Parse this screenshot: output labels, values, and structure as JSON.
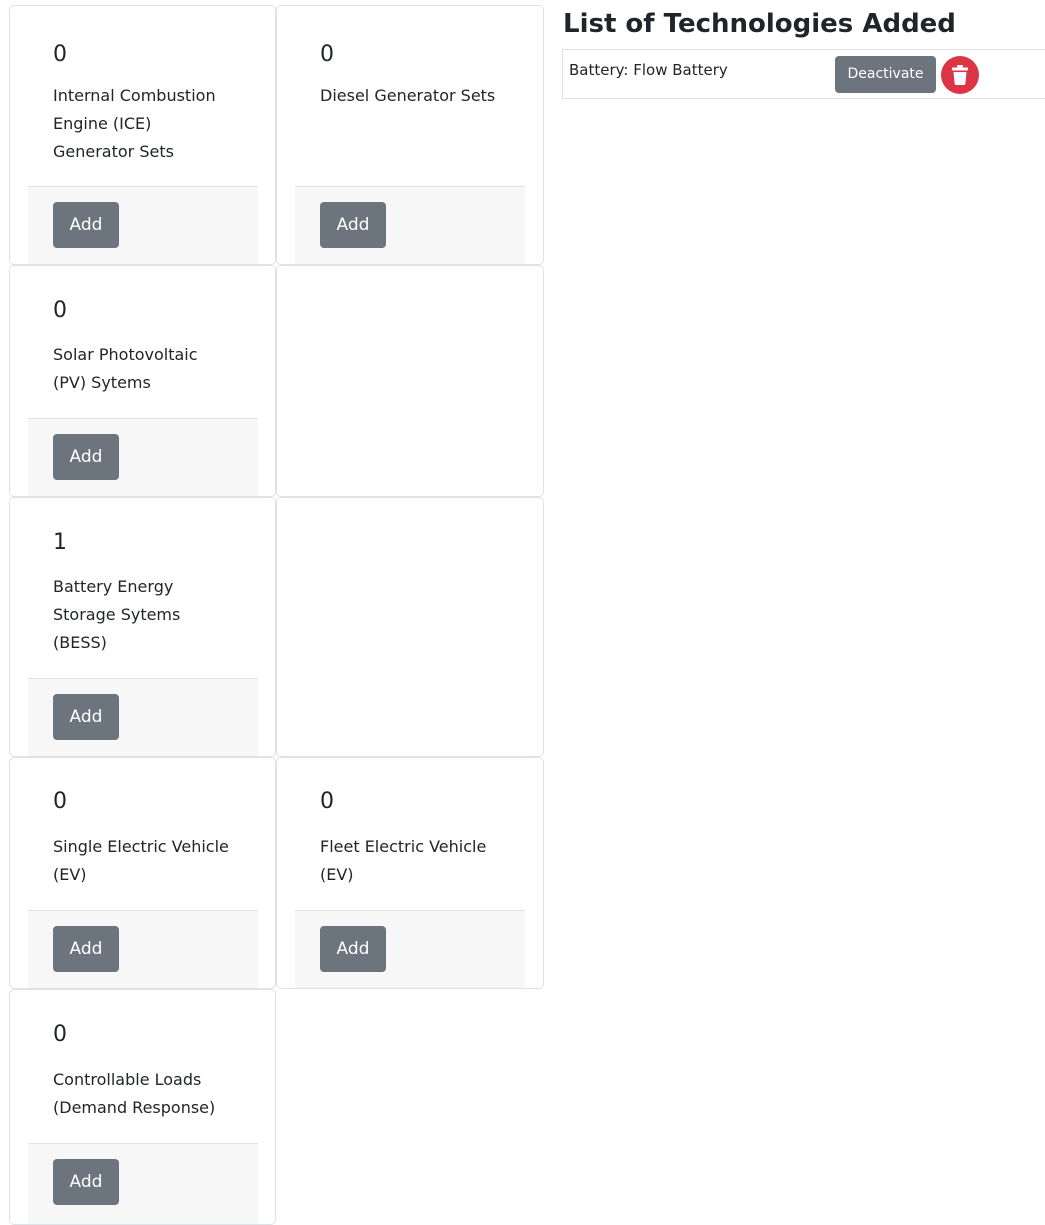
{
  "technologies": [
    {
      "count": "0",
      "title": "Internal Combustion\nEngine (ICE)\nGenerator Sets",
      "button": "Add"
    },
    {
      "count": "0",
      "title": "Diesel Generator Sets",
      "button": "Add"
    },
    {
      "count": "0",
      "title": "Solar Photovoltaic\n(PV) Sytems",
      "button": "Add"
    },
    {
      "count": "1",
      "title": "Battery Energy\nStorage Sytems\n(BESS)",
      "button": "Add"
    },
    {
      "count": "0",
      "title": "Single Electric Vehicle\n(EV)",
      "button": "Add"
    },
    {
      "count": "0",
      "title": "Fleet Electric Vehicle\n(EV)",
      "button": "Add"
    },
    {
      "count": "0",
      "title": "Controllable Loads\n(Demand Response)",
      "button": "Add"
    }
  ],
  "added_list": {
    "heading": "List of Technologies Added",
    "items": [
      {
        "label": "Battery: Flow Battery",
        "deactivate": "Deactivate",
        "delete_icon": "trash-icon"
      }
    ]
  },
  "colors": {
    "secondary": "#6c757d",
    "danger": "#dc3545",
    "footer_bg": "#f7f7f7",
    "border": "#dee2e6"
  }
}
